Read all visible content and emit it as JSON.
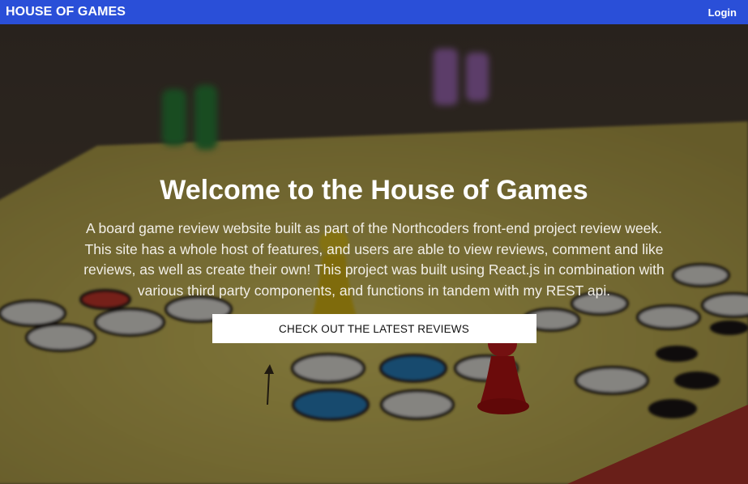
{
  "navbar": {
    "brand": "HOUSE OF GAMES",
    "login_label": "Login",
    "background_color": "#2a4fd8"
  },
  "hero": {
    "title": "Welcome to the House of Games",
    "description": "A board game review website built as part of the Northcoders front-end project review week. This site has a whole host of features, and users are able to view reviews, comment and like reviews, as well as create their own! This project was built using React.js in combination with various third party components, and functions in tandem with my REST api.",
    "cta_label": "CHECK OUT THE LATEST REVIEWS"
  }
}
